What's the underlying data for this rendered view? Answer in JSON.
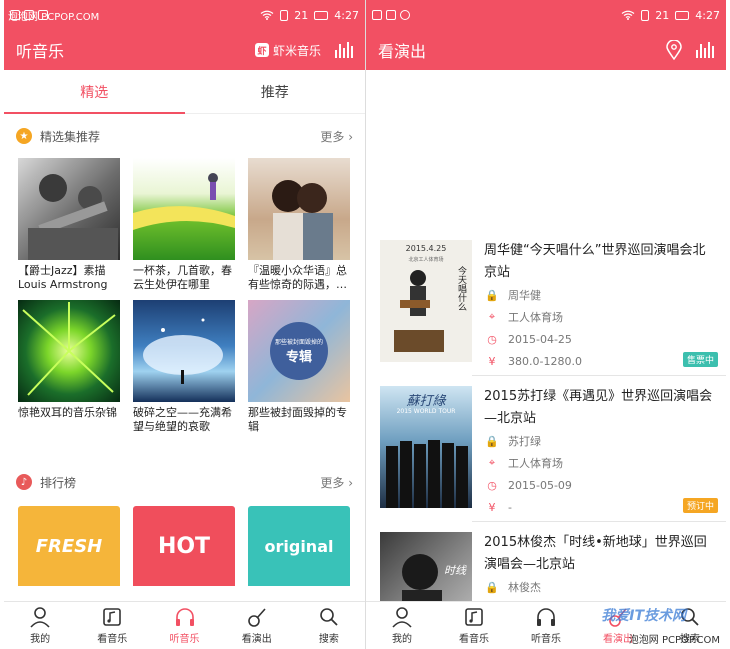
{
  "watermarks": {
    "top_left": "泡泡网 PCPOP.COM",
    "bottom_right": "泡泡网 PCPOP.COM",
    "bottom_right_logo": "我爱IT技术网"
  },
  "status": {
    "signal": "21",
    "time": "4:27"
  },
  "left": {
    "title": "听音乐",
    "xiami_badge": "虾",
    "xiami_label": "虾米音乐",
    "tabs": [
      "精选",
      "推荐"
    ],
    "section_featured": {
      "title": "精选集推荐",
      "more": "更多"
    },
    "cards": [
      {
        "caption": "【爵士Jazz】素描Louis Armstrong"
      },
      {
        "caption": "一杯茶，几首歌，春云生处伊在哪里"
      },
      {
        "caption": "『温暖小众华语』总有些惊奇的际遇，…"
      },
      {
        "caption": "惊艳双耳的音乐杂锦"
      },
      {
        "caption": "破碎之空——充满希望与绝望的哀歌"
      },
      {
        "caption": "那些被封面毁掉的专辑"
      }
    ],
    "album_overlay": {
      "top": "那些被封面毁掉的",
      "big": "专辑"
    },
    "section_rank": {
      "title": "排行榜",
      "more": "更多"
    },
    "rank_tiles": [
      "FRESH",
      "HOT",
      "original"
    ],
    "colors": {
      "accent": "#f25063",
      "fresh": "#f5b53a",
      "hot": "#f04e5c",
      "original": "#39c2b8",
      "star": "#f5a623",
      "onsale": "#3cbfae",
      "preorder": "#f5a623"
    }
  },
  "right": {
    "title": "看演出",
    "shows": [
      {
        "title": "周华健“今天唱什么”世界巡回演唱会北京站",
        "artist": "周华健",
        "venue": "工人体育场",
        "date": "2015-04-25",
        "price": "380.0-1280.0",
        "badge": "售票中",
        "poster_date": "2015.4.25",
        "poster_venue": "北京工人体育场",
        "poster_text": "今天唱什么"
      },
      {
        "title": "2015苏打绿《再遇见》世界巡回演唱会—北京站",
        "artist": "苏打绿",
        "venue": "工人体育场",
        "date": "2015-05-09",
        "price": "-",
        "badge": "预订中",
        "poster_text": "蘇打綠",
        "poster_sub": "2015 WORLD TOUR"
      },
      {
        "title": "2015林俊杰「时线•新地球」世界巡回演唱会—北京站",
        "artist": "林俊杰",
        "poster_text": "时线"
      }
    ]
  },
  "nav": [
    "我的",
    "看音乐",
    "听音乐",
    "看演出",
    "搜索"
  ],
  "icons": {
    "star": "★",
    "note": "♪",
    "lock": "🔒",
    "pin": "⌖",
    "clock": "◷",
    "yen": "¥"
  }
}
